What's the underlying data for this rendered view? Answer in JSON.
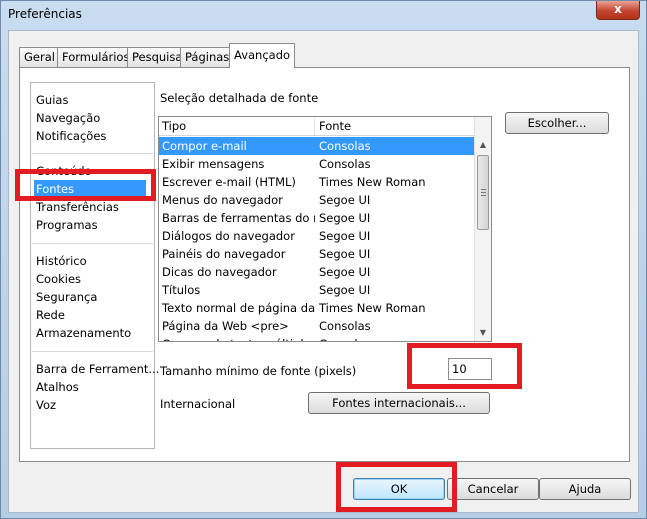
{
  "window": {
    "title": "Preferências",
    "close_glyph": "x"
  },
  "tabs": [
    {
      "label": "Geral",
      "active": false
    },
    {
      "label": "Formulários",
      "active": false
    },
    {
      "label": "Pesquisa",
      "active": false
    },
    {
      "label": "Páginas",
      "active": false
    },
    {
      "label": "Avançado",
      "active": true
    }
  ],
  "nav": {
    "groups": [
      [
        "Guias",
        "Navegação",
        "Notificações"
      ],
      [
        "Conteúdo",
        "Fontes",
        "Transferências",
        "Programas"
      ],
      [
        "Histórico",
        "Cookies",
        "Segurança",
        "Rede",
        "Armazenamento"
      ],
      [
        "Barra de Ferrament...",
        "Atalhos",
        "Voz"
      ]
    ],
    "selected": "Fontes"
  },
  "fonts_section": {
    "label": "Seleção detalhada de fonte",
    "columns": [
      "Tipo",
      "Fonte"
    ],
    "selected_row": 0,
    "rows": [
      [
        "Compor e-mail",
        "Consolas"
      ],
      [
        "Exibir mensagens",
        "Consolas"
      ],
      [
        "Escrever e-mail (HTML)",
        "Times New Roman"
      ],
      [
        "Menus do navegador",
        "Segoe UI"
      ],
      [
        "Barras de ferramentas do n...",
        "Segoe UI"
      ],
      [
        "Diálogos do navegador",
        "Segoe UI"
      ],
      [
        "Painéis do navegador",
        "Segoe UI"
      ],
      [
        "Dicas do navegador",
        "Segoe UI"
      ],
      [
        "Títulos",
        "Segoe UI"
      ],
      [
        "Texto normal de página da ...",
        "Times New Roman"
      ],
      [
        "Página da Web <pre>",
        "Consolas"
      ],
      [
        "Campos de texto múltiplo d...",
        "Consolas"
      ]
    ],
    "choose_button": "Escolher...",
    "min_size_label": "Tamanho mínimo de fonte (pixels)",
    "min_size_value": "10",
    "intl_label": "Internacional",
    "intl_button": "Fontes internacionais..."
  },
  "footer": {
    "ok": "OK",
    "cancel": "Cancelar",
    "help": "Ajuda"
  },
  "colors": {
    "highlight": "#e31c24",
    "selection": "#3399ff"
  }
}
